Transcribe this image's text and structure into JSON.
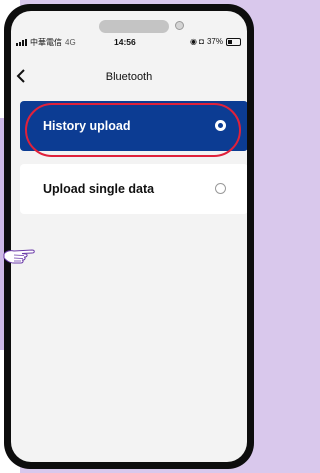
{
  "statusbar": {
    "carrier": "中華電信",
    "network": "4G",
    "time": "14:56",
    "icons": "◉ ◘",
    "battery": "37%",
    "battery_level": 0.37
  },
  "navbar": {
    "back_icon": "chevron-left-icon",
    "title": "Bluetooth"
  },
  "options": [
    {
      "label": "History upload",
      "selected": true
    },
    {
      "label": "Upload single data",
      "selected": false
    }
  ],
  "colors": {
    "accent": "#0c3c93",
    "highlight": "#e0213b",
    "background": "#f3f3f3"
  }
}
